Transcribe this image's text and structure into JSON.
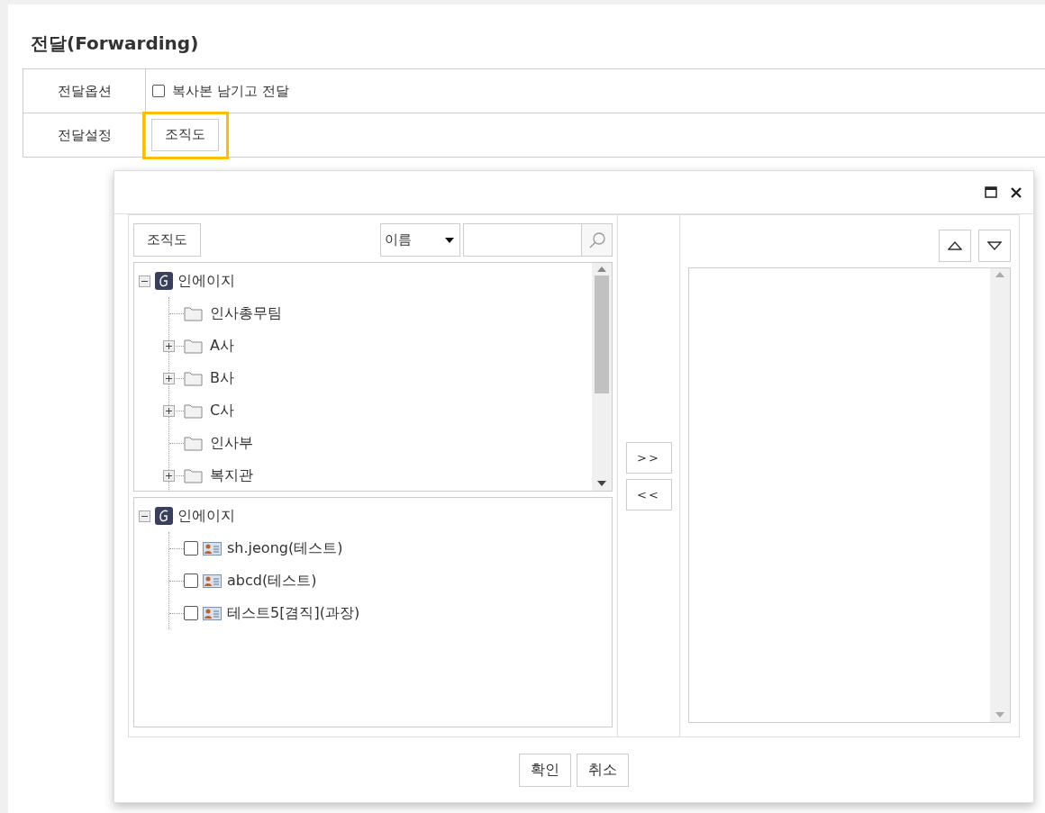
{
  "page": {
    "title": "전달(Forwarding)"
  },
  "form": {
    "rows": [
      {
        "label": "전달옵션",
        "kind": "checkbox",
        "checked": false,
        "text": "복사본 남기고 전달"
      },
      {
        "label": "전달설정",
        "kind": "button",
        "text": "조직도",
        "highlighted": true
      }
    ]
  },
  "dialog": {
    "org_button": "조직도",
    "search": {
      "field": "이름"
    },
    "tree": {
      "label": "인에이지",
      "expanded": true,
      "children": [
        {
          "label": "인사총무팀",
          "expandable": false
        },
        {
          "label": "A사",
          "expandable": true
        },
        {
          "label": "B사",
          "expandable": true
        },
        {
          "label": "C사",
          "expandable": true
        },
        {
          "label": "인사부",
          "expandable": false
        },
        {
          "label": "복지관",
          "expandable": true
        }
      ]
    },
    "members": {
      "label": "인에이지",
      "expanded": true,
      "items": [
        {
          "name": "sh.jeong(테스트)",
          "checked": false
        },
        {
          "name": "abcd(테스트)",
          "checked": false
        },
        {
          "name": "테스트5[겸직](과장)",
          "checked": false
        }
      ]
    },
    "transfer_buttons": [
      ">>",
      "<<"
    ],
    "footer_buttons": [
      "확인",
      "취소"
    ]
  }
}
